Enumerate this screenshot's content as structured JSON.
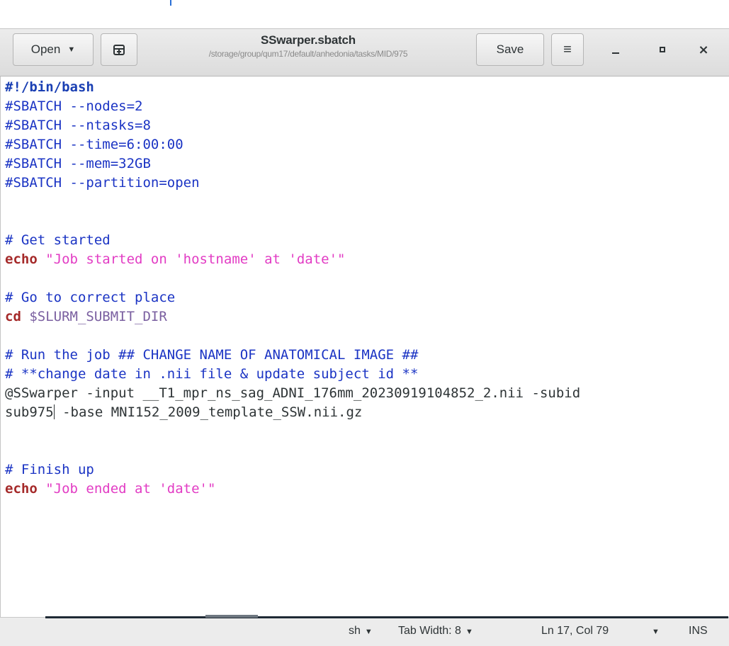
{
  "window": {
    "title": "SSwarper.sbatch",
    "path": "/storage/group/qum17/default/anhedonia/tasks/MID/975"
  },
  "toolbar": {
    "open_label": "Open",
    "open_caret": "▼",
    "new_tab_icon": "new-tab-icon",
    "save_label": "Save",
    "menu_icon": "≡",
    "close_glyph": "×"
  },
  "code_lines": [
    [
      {
        "t": "shebang",
        "v": "#!/bin/bash"
      }
    ],
    [
      {
        "t": "comment",
        "v": "#SBATCH --nodes=2"
      }
    ],
    [
      {
        "t": "comment",
        "v": "#SBATCH --ntasks=8"
      }
    ],
    [
      {
        "t": "comment",
        "v": "#SBATCH --time=6:00:00"
      }
    ],
    [
      {
        "t": "comment",
        "v": "#SBATCH --mem=32GB"
      }
    ],
    [
      {
        "t": "comment",
        "v": "#SBATCH --partition=open"
      }
    ],
    [],
    [],
    [
      {
        "t": "comment",
        "v": "# Get started"
      }
    ],
    [
      {
        "t": "keyword",
        "v": "echo"
      },
      {
        "t": "plain",
        "v": " "
      },
      {
        "t": "string",
        "v": "\"Job started on 'hostname' at 'date'\""
      }
    ],
    [],
    [
      {
        "t": "comment",
        "v": "# Go to correct place"
      }
    ],
    [
      {
        "t": "keyword",
        "v": "cd"
      },
      {
        "t": "plain",
        "v": " "
      },
      {
        "t": "var",
        "v": "$SLURM_SUBMIT_DIR"
      }
    ],
    [],
    [
      {
        "t": "comment",
        "v": "# Run the job ## CHANGE NAME OF ANATOMICAL IMAGE ##"
      }
    ],
    [
      {
        "t": "comment",
        "v": "# **change date in .nii file & update subject id **"
      }
    ],
    [
      {
        "t": "plain",
        "v": "@SSwarper -input __T1_mpr_ns_sag_ADNI_176mm_20230919104852_2.nii -subid"
      }
    ],
    [
      {
        "t": "plain",
        "v": "sub975"
      },
      {
        "t": "cursor",
        "v": ""
      },
      {
        "t": "plain",
        "v": " -base MNI152_2009_template_SSW.nii.gz"
      }
    ],
    [],
    [],
    [
      {
        "t": "comment",
        "v": "# Finish up"
      }
    ],
    [
      {
        "t": "keyword",
        "v": "echo"
      },
      {
        "t": "plain",
        "v": " "
      },
      {
        "t": "string",
        "v": "\"Job ended at 'date'\""
      }
    ]
  ],
  "statusbar": {
    "language": "sh",
    "tab_width": "Tab Width: 8",
    "position": "Ln 17, Col 79",
    "mode": "INS",
    "caret": "▼"
  }
}
